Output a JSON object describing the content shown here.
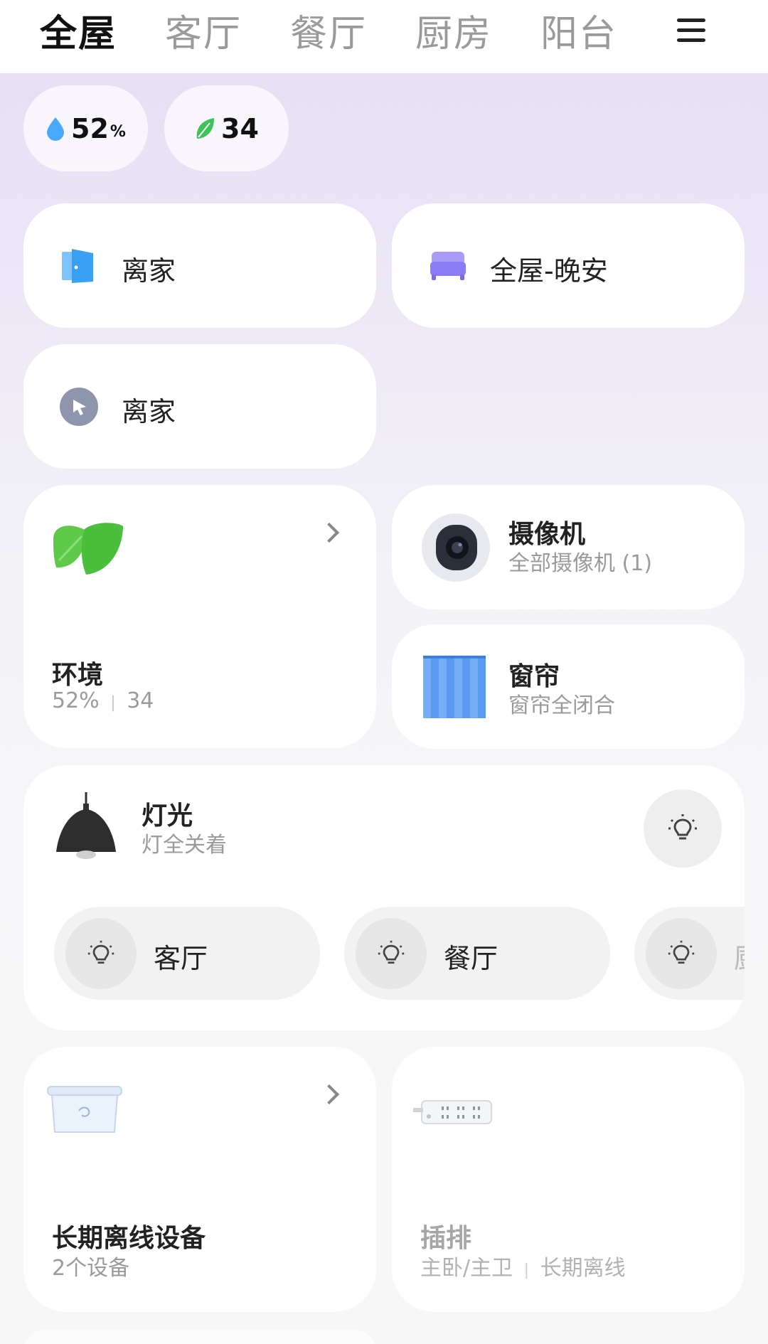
{
  "tabs": [
    {
      "label": "全屋",
      "active": true
    },
    {
      "label": "客厅",
      "active": false
    },
    {
      "label": "餐厅",
      "active": false
    },
    {
      "label": "厨房",
      "active": false
    },
    {
      "label": "阳台",
      "active": false
    }
  ],
  "status": {
    "humidity": {
      "value": "52",
      "unit": "%"
    },
    "air": {
      "value": "34"
    }
  },
  "scenes": [
    {
      "label": "离家",
      "icon": "door-icon"
    },
    {
      "label": "全屋-晚安",
      "icon": "bed-icon"
    },
    {
      "label": "离家",
      "icon": "cursor-icon"
    }
  ],
  "environment": {
    "title": "环境",
    "humidity": "52%",
    "separator": "|",
    "air": "34"
  },
  "camera": {
    "title": "摄像机",
    "sub": "全部摄像机 (1)"
  },
  "curtain": {
    "title": "窗帘",
    "sub": "窗帘全闭合"
  },
  "lights": {
    "title": "灯光",
    "sub": "灯全关着",
    "rooms": [
      "客厅",
      "餐厅",
      "厨"
    ]
  },
  "offline": {
    "title": "长期离线设备",
    "sub": "2个设备"
  },
  "strip": {
    "title": "插排",
    "location": "主卧/主卫",
    "separator": "|",
    "status": "长期离线"
  },
  "colors": {
    "accent": "#111111",
    "muted": "#9a9a9a",
    "water": "#4aa8ff",
    "leaf": "#3cc35a",
    "bed": "#8a7cf5"
  }
}
